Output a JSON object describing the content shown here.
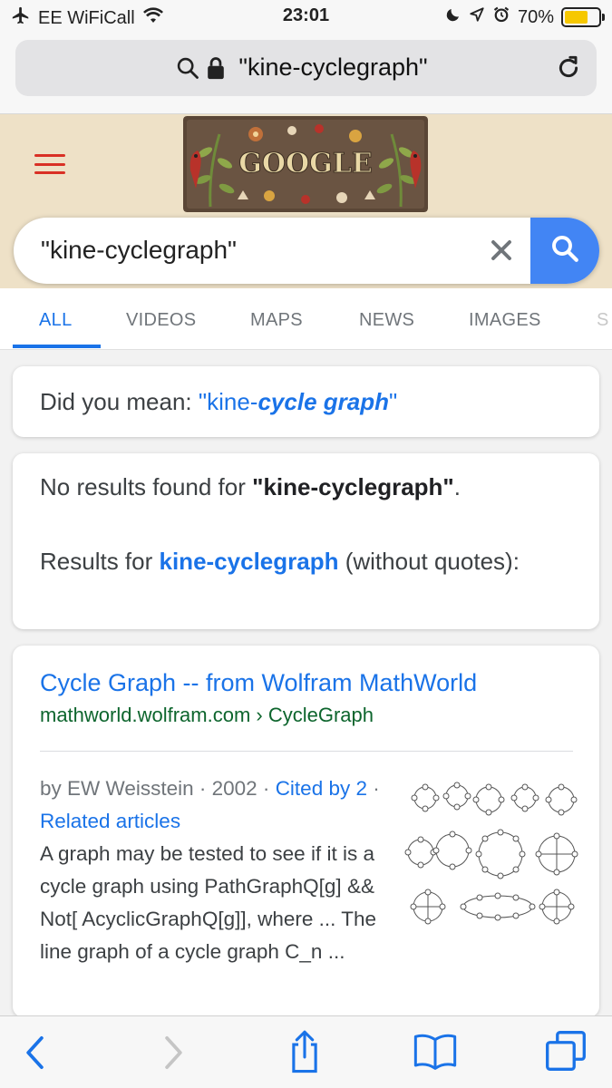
{
  "status": {
    "carrier": "EE WiFiCall",
    "time": "23:01",
    "battery": "70%",
    "battery_level": 0.7
  },
  "browser": {
    "url_text": "\"kine-cyclegraph\""
  },
  "search": {
    "query": "\"kine-cyclegraph\""
  },
  "tabs": [
    {
      "label": "ALL",
      "active": true
    },
    {
      "label": "VIDEOS"
    },
    {
      "label": "MAPS"
    },
    {
      "label": "NEWS"
    },
    {
      "label": "IMAGES"
    },
    {
      "label": "S"
    }
  ],
  "suggestion": {
    "prefix": "Did you mean: ",
    "link_start": "\"kine-",
    "link_emph": "cycle graph",
    "link_end": "\""
  },
  "no_results": {
    "text": "No results found for ",
    "query": "\"kine-cyclegraph\"",
    "end": ".",
    "results_for": "Results for ",
    "alt_query": "kine-cyclegraph",
    "results_end": " (without quotes):"
  },
  "result": {
    "title": "Cycle Graph -- from Wolfram MathWorld",
    "url": "mathworld.wolfram.com › CycleGraph",
    "meta_author": "by EW Weisstein · 2002 · ",
    "cited": "Cited by 2",
    "sep": " · ",
    "related": "Related articles",
    "snippet": "A graph may be tested to see if it is a cycle graph using PathGraphQ[g] && Not[ AcyclicGraphQ[g]], where ... The line graph of a cycle graph C_n ..."
  },
  "colors": {
    "link": "#1a73e8",
    "url_green": "#0d652d",
    "search_button": "#4285f4",
    "menu_red": "#d93025",
    "header_bg": "#eee1c7",
    "battery_fill": "#f6c800"
  }
}
